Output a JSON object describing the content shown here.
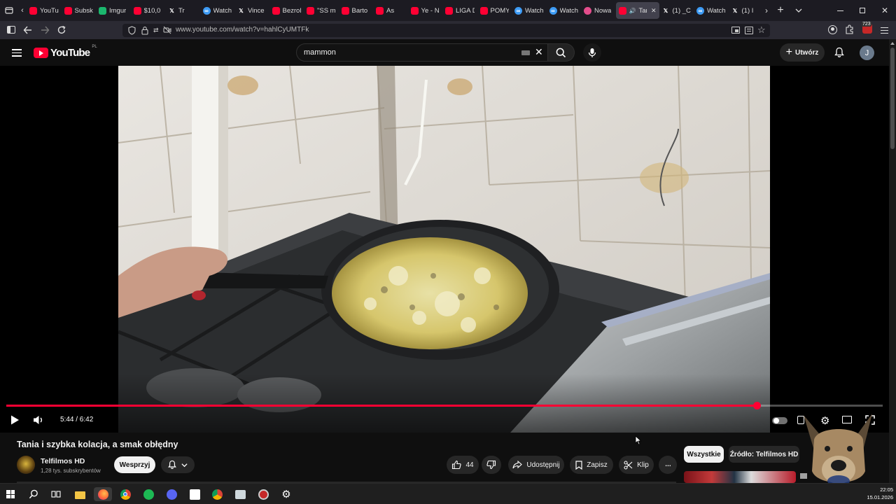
{
  "browser": {
    "tabs": [
      {
        "label": "YouTu",
        "icon": "youtube-icon",
        "color": "#ff0033"
      },
      {
        "label": "Subsk",
        "icon": "youtube-icon",
        "color": "#ff0033"
      },
      {
        "label": "Imgur",
        "icon": "imgur-icon",
        "color": "#1bb76e"
      },
      {
        "label": "$10,0",
        "icon": "youtube-icon",
        "color": "#ff0033"
      },
      {
        "label": "Tr",
        "icon": "x-icon",
        "color": "#ffffff"
      },
      {
        "label": "Watch",
        "icon": "watch-icon",
        "color": "#3d9bf5"
      },
      {
        "label": "Vince",
        "icon": "x-icon",
        "color": "#ffffff"
      },
      {
        "label": "Bezrol",
        "icon": "youtube-icon",
        "color": "#ff0033"
      },
      {
        "label": "\"SS m",
        "icon": "youtube-icon",
        "color": "#ff0033"
      },
      {
        "label": "Barto",
        "icon": "youtube-icon",
        "color": "#ff0033"
      },
      {
        "label": "As",
        "icon": "youtube-icon",
        "color": "#ff0033"
      },
      {
        "label": "Ye - N",
        "icon": "youtube-icon",
        "color": "#ff0033"
      },
      {
        "label": "LIGA D",
        "icon": "youtube-icon",
        "color": "#ff0033"
      },
      {
        "label": "POMY",
        "icon": "youtube-icon",
        "color": "#ff0033"
      },
      {
        "label": "Watch",
        "icon": "watch-icon",
        "color": "#3d9bf5"
      },
      {
        "label": "Watch",
        "icon": "watch-icon",
        "color": "#3d9bf5"
      },
      {
        "label": "Nowa",
        "icon": "nowa-icon",
        "color": "#e44d8c"
      },
      {
        "label": "Tan",
        "icon": "youtube-icon",
        "color": "#ff0033",
        "active": true
      },
      {
        "label": "(1) _C",
        "icon": "x-icon",
        "color": "#ffffff"
      },
      {
        "label": "Watch",
        "icon": "watch-icon",
        "color": "#3d9bf5"
      },
      {
        "label": "(1) I",
        "icon": "x-icon",
        "color": "#ffffff"
      }
    ],
    "url": "www.youtube.com/watch?v=hahlCyUMTFk",
    "notification_count": "723"
  },
  "youtube": {
    "logo_text": "YouTube",
    "region": "PL",
    "search_query": "mammon",
    "create_label": "Utwórz",
    "avatar_letter": "J",
    "accent": "#ff0033"
  },
  "player": {
    "time": "5:44 / 6:42",
    "progress": 0.857
  },
  "video": {
    "title": "Tania i szybka kolacja, a smak obłędny",
    "channel": "Telfilmos HD",
    "subscribers": "1,28 tys. subskrybentów",
    "support_label": "Wesprzyj",
    "likes": "44",
    "share_label": "Udostępnij",
    "save_label": "Zapisz",
    "clip_label": "Klip"
  },
  "filters": {
    "all_label": "Wszystkie",
    "source_label": "Źródło: Telfilmos HD"
  },
  "taskbar": {
    "time": "22:05",
    "date": "15.01.2026"
  }
}
